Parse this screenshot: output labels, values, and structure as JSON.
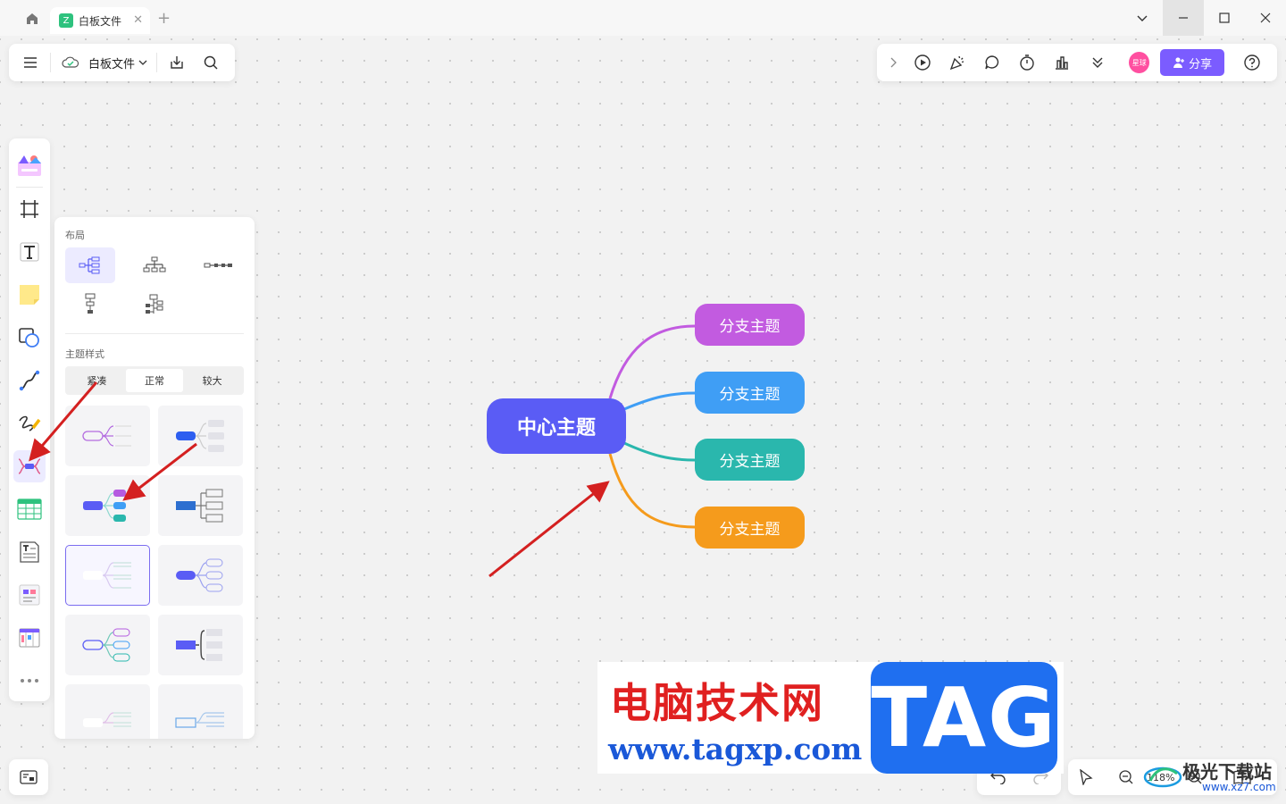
{
  "titlebar": {
    "tab_label": "白板文件",
    "tab_icon_glyph": "Z",
    "add_tab_glyph": "+",
    "close_tab_glyph": "✕"
  },
  "toolbar_left": {
    "file_name": "白板文件"
  },
  "toolbar_right": {
    "avatar_text": "星球",
    "share_label": "分享"
  },
  "panel": {
    "layout_label": "布局",
    "style_label": "主题样式",
    "density_options": [
      "紧凑",
      "正常",
      "较大"
    ],
    "density_selected": "正常"
  },
  "mindmap": {
    "center": "中心主题",
    "branches": [
      {
        "label": "分支主题",
        "color": "#c25be0"
      },
      {
        "label": "分支主题",
        "color": "#3f9ef5"
      },
      {
        "label": "分支主题",
        "color": "#2ab7ad"
      },
      {
        "label": "分支主题",
        "color": "#f59b1c"
      }
    ],
    "center_color": "#5a5cf5"
  },
  "zoom": {
    "level": "118%"
  },
  "watermark": {
    "title": "电脑技术网",
    "url": "www.tagxp.com",
    "tag": "TAG",
    "corner_title": "极光下载站",
    "corner_url": "www.xz7.com"
  },
  "colors": {
    "accent": "#7b5cff",
    "arrow": "#d42020"
  }
}
